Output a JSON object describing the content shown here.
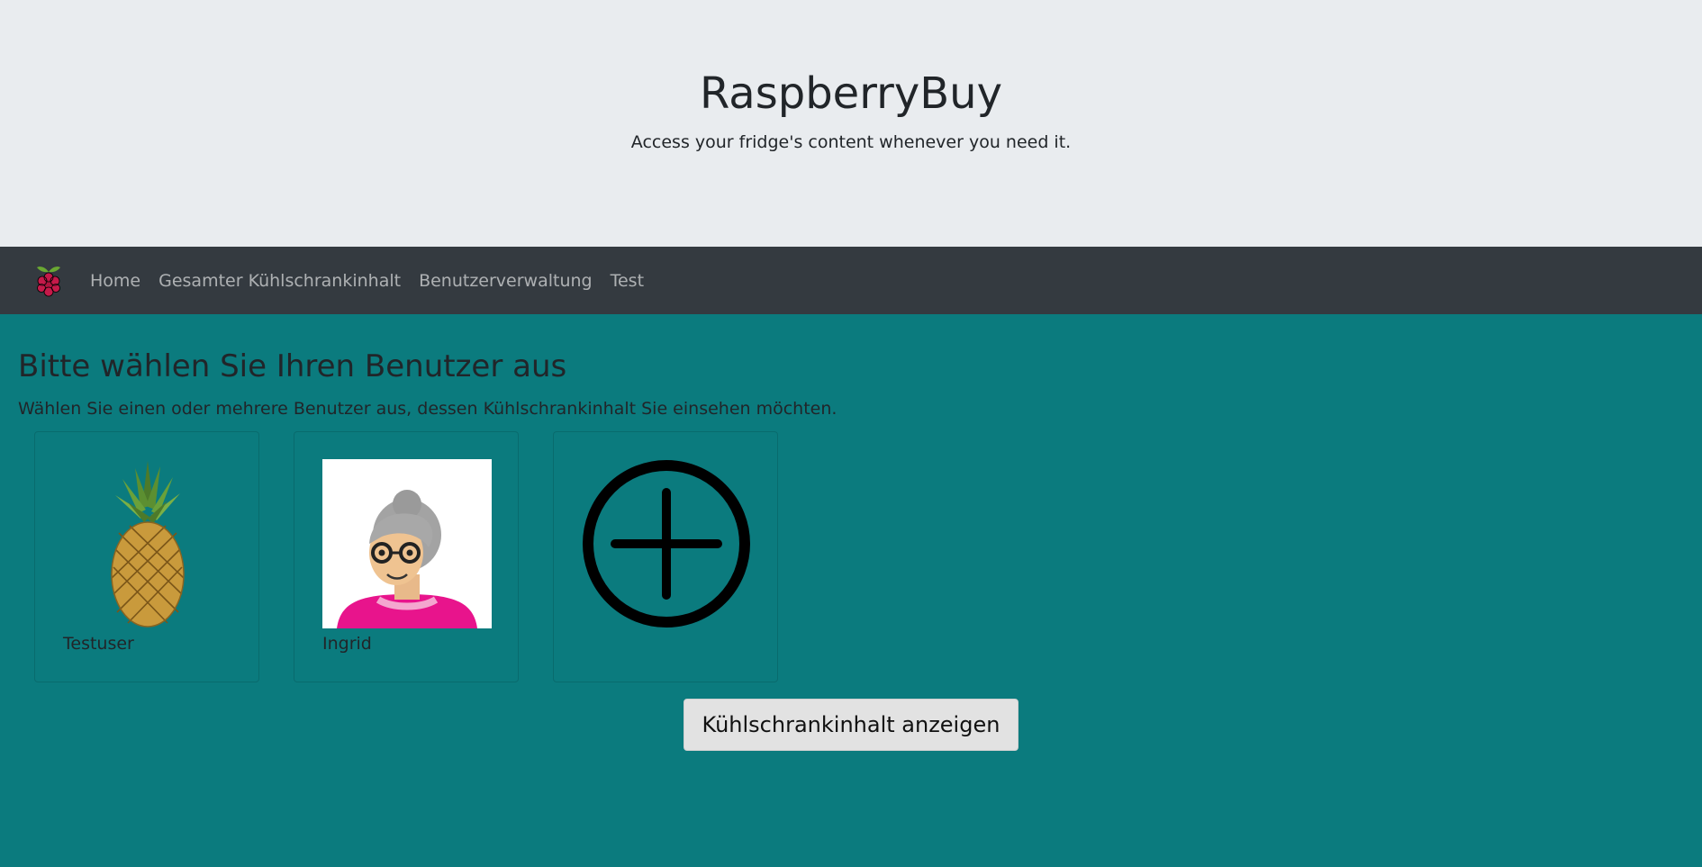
{
  "header": {
    "title": "RaspberryBuy",
    "subtitle": "Access your fridge's content whenever you need it."
  },
  "nav": {
    "logo_icon": "raspberry-icon",
    "items": [
      "Home",
      "Gesamter Kühlschrankinhalt",
      "Benutzerverwaltung",
      "Test"
    ]
  },
  "main": {
    "heading": "Bitte wählen Sie Ihren Benutzer aus",
    "description": "Wählen Sie einen oder mehrere Benutzer aus, dessen Kühlschrankinhalt Sie einsehen möchten.",
    "users": [
      {
        "name": "Testuser",
        "avatar_icon": "pineapple-icon"
      },
      {
        "name": "Ingrid",
        "avatar_icon": "grandmother-avatar-icon"
      }
    ],
    "add_user_icon": "plus-circle-icon",
    "submit_label": "Kühlschrankinhalt anzeigen"
  },
  "colors": {
    "background": "#0b7b7e",
    "header_bg": "#e9ecef",
    "navbar_bg": "#343a40"
  }
}
